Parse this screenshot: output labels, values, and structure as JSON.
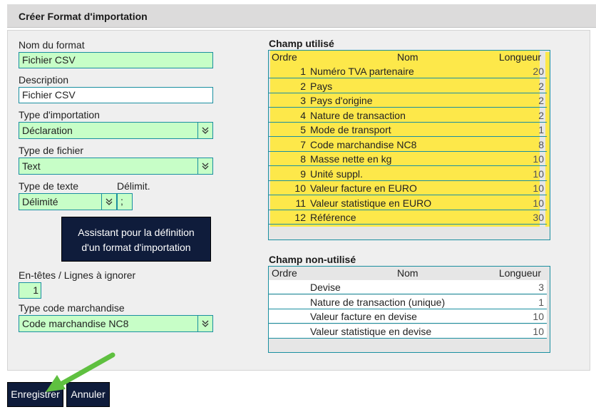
{
  "header": {
    "title": "Créer Format d'importation"
  },
  "form": {
    "nom_label": "Nom du format",
    "nom_value": "Fichier CSV",
    "description_label": "Description",
    "description_value": "Fichier CSV",
    "type_import_label": "Type d'importation",
    "type_import_value": "Déclaration",
    "type_fichier_label": "Type de fichier",
    "type_fichier_value": "Text",
    "type_texte_label": "Type de texte",
    "type_texte_value": "Délimité",
    "delimit_label": "Délimit.",
    "delimit_value": ";",
    "wizard_line1": "Assistant pour la définition",
    "wizard_line2": "d'un format d'importation",
    "entetes_label": "En-têtes / Lignes à ignorer",
    "entetes_value": "1",
    "type_code_label": "Type code marchandise",
    "type_code_value": "Code marchandise NC8"
  },
  "used": {
    "title": "Champ utilisé",
    "headers": {
      "ordre": "Ordre",
      "nom": "Nom",
      "longueur": "Longueur"
    },
    "rows": [
      {
        "ordre": "1",
        "nom": "Numéro TVA partenaire",
        "longueur": "20"
      },
      {
        "ordre": "2",
        "nom": "Pays",
        "longueur": "2"
      },
      {
        "ordre": "3",
        "nom": "Pays d'origine",
        "longueur": "2"
      },
      {
        "ordre": "4",
        "nom": "Nature de transaction",
        "longueur": "2"
      },
      {
        "ordre": "5",
        "nom": "Mode de transport",
        "longueur": "1"
      },
      {
        "ordre": "7",
        "nom": "Code marchandise NC8",
        "longueur": "8"
      },
      {
        "ordre": "8",
        "nom": "Masse nette en kg",
        "longueur": "10"
      },
      {
        "ordre": "9",
        "nom": "Unité suppl.",
        "longueur": "10"
      },
      {
        "ordre": "10",
        "nom": "Valeur facture en EURO",
        "longueur": "10"
      },
      {
        "ordre": "11",
        "nom": "Valeur statistique en EURO",
        "longueur": "10"
      },
      {
        "ordre": "12",
        "nom": "Référence",
        "longueur": "30"
      }
    ]
  },
  "unused": {
    "title": "Champ non-utilisé",
    "headers": {
      "ordre": "Ordre",
      "nom": "Nom",
      "longueur": "Longueur"
    },
    "rows": [
      {
        "ordre": "",
        "nom": "Devise",
        "longueur": "3"
      },
      {
        "ordre": "",
        "nom": "Nature de transaction (unique)",
        "longueur": "1"
      },
      {
        "ordre": "",
        "nom": "Valeur facture en devise",
        "longueur": "10"
      },
      {
        "ordre": "",
        "nom": "Valeur statistique en devise",
        "longueur": "10"
      }
    ]
  },
  "footer": {
    "save_label": "Enregistrer",
    "cancel_label": "Annuler"
  },
  "colors": {
    "highlight": "#fde84a",
    "field_green": "#c7fec7",
    "button_navy": "#0f1c3b",
    "border_teal": "#1a8fa0",
    "arrow_green": "#5fc040"
  }
}
